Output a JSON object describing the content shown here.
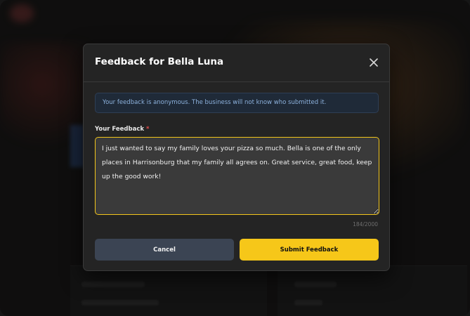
{
  "modal": {
    "title": "Feedback for Bella Luna",
    "close_icon": "close-icon",
    "notice": "Your feedback is anonymous. The business will not know who submitted it.",
    "field_label": "Your Feedback",
    "required_marker": "*",
    "feedback_value": "I just wanted to say my family loves your pizza so much. Bella is one of the only places in Harrisonburg that my family all agrees on. Great service, great food, keep up the good work!",
    "char_count": "184/2000",
    "cancel_label": "Cancel",
    "submit_label": "Submit Feedback"
  },
  "colors": {
    "accent": "#f6c719",
    "notice_text": "#8db2dd",
    "required": "#e24b4b",
    "cancel_bg": "#3b4453"
  }
}
